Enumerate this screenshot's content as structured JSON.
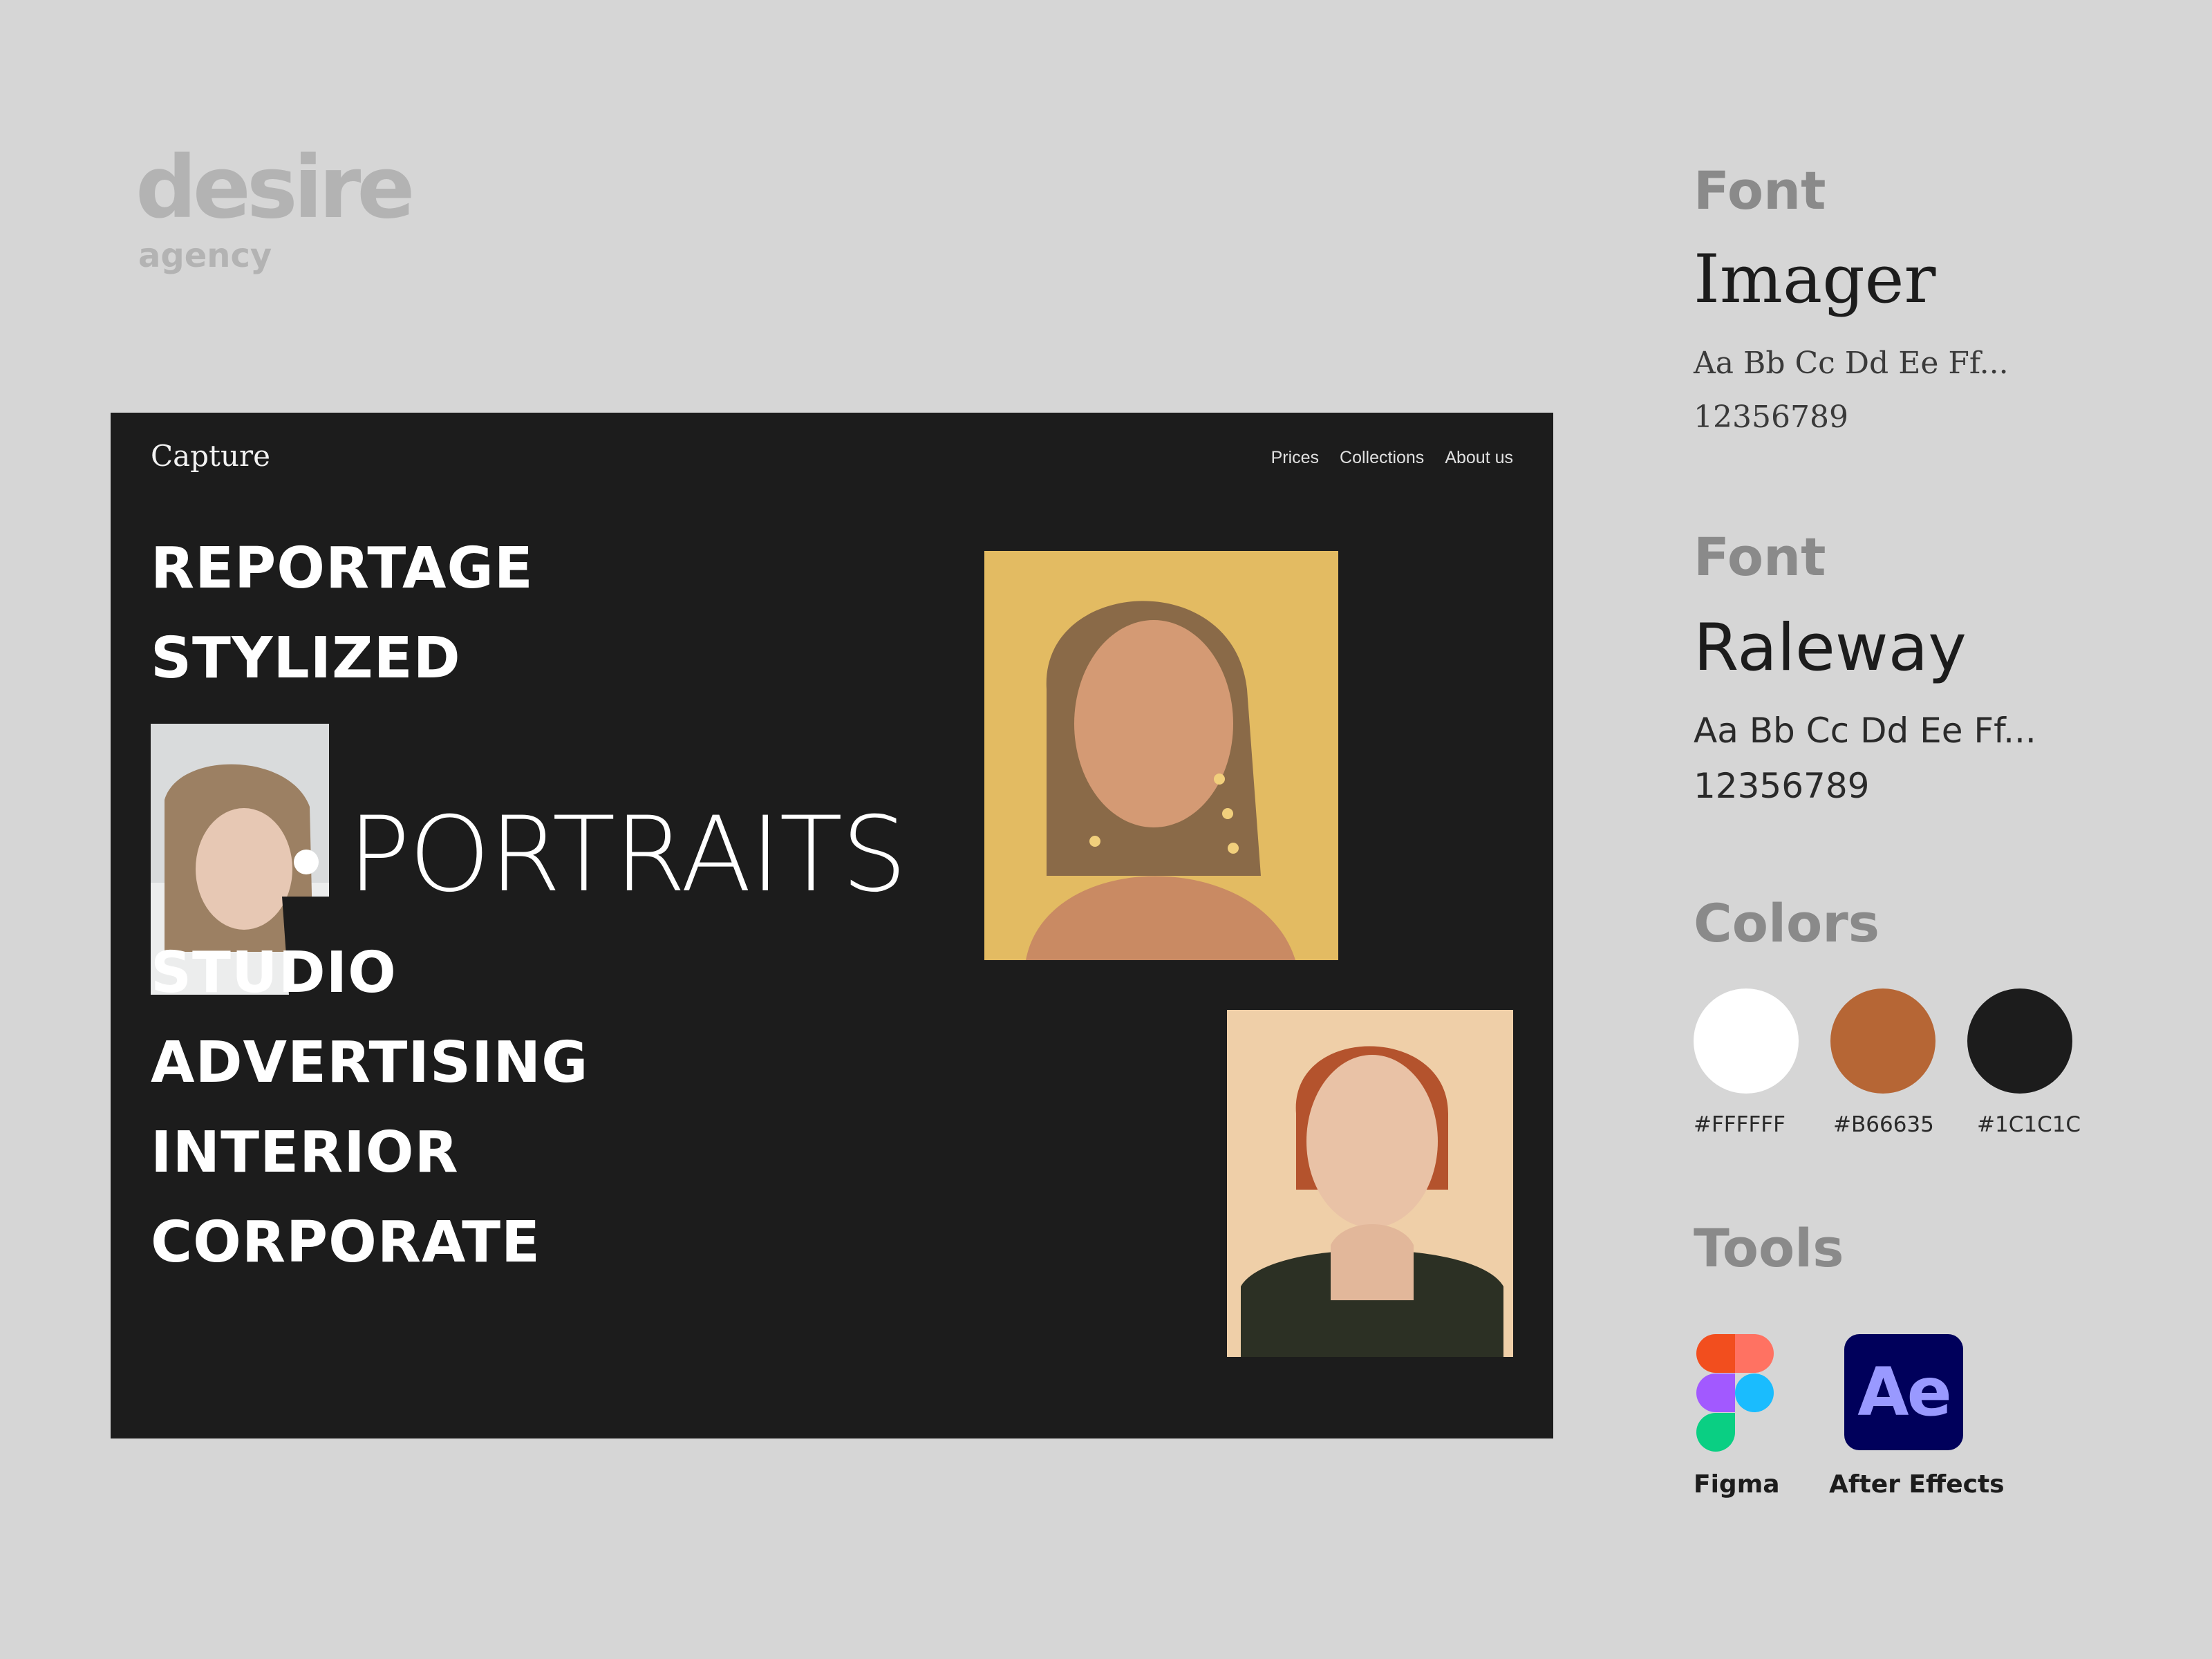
{
  "brand": {
    "name": "desire",
    "sub": "agency"
  },
  "site": {
    "logo": "Capture",
    "nav": [
      "Prices",
      "Collections",
      "About us"
    ],
    "categories_top": [
      "REPORTAGE",
      "STYLIZED"
    ],
    "featured": "PORTRAITS",
    "categories_bottom": [
      "STUDIO",
      "ADVERTISING",
      "INTERIOR",
      "CORPORATE"
    ],
    "photos": [
      "portrait-photo-1",
      "portrait-photo-2",
      "portrait-photo-3"
    ]
  },
  "fonts": [
    {
      "heading": "Font",
      "name": "Imager",
      "sample": "Aa Bb Cc Dd Ee Ff...",
      "digits": "12356789"
    },
    {
      "heading": "Font",
      "name": "Raleway",
      "sample": "Aa Bb Cc Dd Ee Ff...",
      "digits": "12356789"
    }
  ],
  "colors": {
    "heading": "Colors",
    "swatches": [
      {
        "hex": "#FFFFFF",
        "label": "#FFFFFF"
      },
      {
        "hex": "#B66635",
        "label": "#B66635"
      },
      {
        "hex": "#1C1C1C",
        "label": "#1C1C1C"
      }
    ]
  },
  "tools": {
    "heading": "Tools",
    "items": [
      {
        "name": "Figma",
        "icon": "figma-icon"
      },
      {
        "name": "After Effects",
        "icon": "after-effects-icon",
        "abbr": "Ae"
      }
    ]
  }
}
